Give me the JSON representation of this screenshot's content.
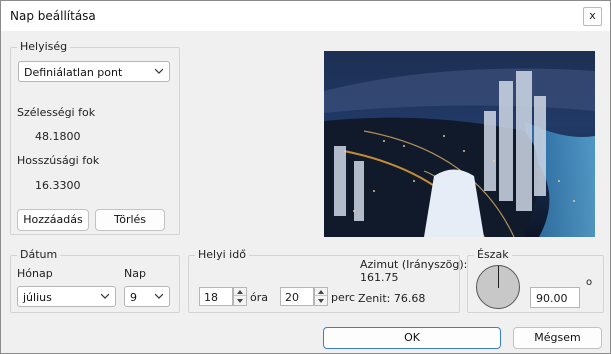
{
  "window": {
    "title": "Nap beállítása",
    "close_label": "x"
  },
  "location": {
    "legend": "Helyiség",
    "selected": "Definiálatlan pont",
    "latitude_label": "Szélességi fok",
    "latitude_value": "48.1800",
    "longitude_label": "Hosszúsági fok",
    "longitude_value": "16.3300",
    "add_label": "Hozzáadás",
    "delete_label": "Törlés"
  },
  "date": {
    "legend": "Dátum",
    "month_label": "Hónap",
    "month_value": "július",
    "day_label": "Nap",
    "day_value": "9"
  },
  "time": {
    "legend": "Helyi idő",
    "hour_value": "18",
    "hour_unit": "óra",
    "minute_value": "20",
    "minute_unit": "perc",
    "azimuth_label": "Azimut (Irányszög):",
    "azimuth_value": "161.75",
    "zenith_text": "Zenit: 76.68"
  },
  "north": {
    "legend": "Észak",
    "value": "90.00",
    "unit": "o"
  },
  "footer": {
    "ok_label": "OK",
    "cancel_label": "Mégsem"
  },
  "icons": {
    "close": "close-icon",
    "dropdown": "chevron-down-icon",
    "spin": "spinner-arrows-icon",
    "photo": "city-night-photo"
  }
}
